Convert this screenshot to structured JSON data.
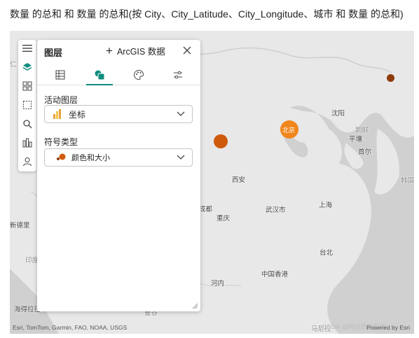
{
  "visual_title": "数量 的总和 和 数量 的总和(按 City、City_Latitude、City_Longitude、城市 和 数量 的总和)",
  "panel": {
    "title": "图层",
    "add_data_label": "ArcGIS 数据",
    "tabs": [
      "layers-tab",
      "symbology-tab",
      "style-tab",
      "settings-tab"
    ],
    "active_layer_label": "活动图层",
    "active_layer_value": "坐标",
    "symbol_type_label": "符号类型",
    "symbol_type_value": "颜色和大小"
  },
  "map": {
    "cities": [
      {
        "name": "北京",
        "style": "on-bubble"
      },
      {
        "name": "沈阳",
        "style": "normal"
      },
      {
        "name": "朝鲜",
        "style": "faint"
      },
      {
        "name": "平壤",
        "style": "normal"
      },
      {
        "name": "首尔",
        "style": "normal"
      },
      {
        "name": "西安",
        "style": "normal"
      },
      {
        "name": "成都",
        "style": "normal"
      },
      {
        "name": "重庆",
        "style": "normal"
      },
      {
        "name": "武汉市",
        "style": "normal"
      },
      {
        "name": "上海",
        "style": "normal"
      },
      {
        "name": "台北",
        "style": "normal"
      },
      {
        "name": "中国香港",
        "style": "normal"
      },
      {
        "name": "河内",
        "style": "normal"
      },
      {
        "name": "新德里",
        "style": "normal"
      },
      {
        "name": "印度",
        "style": "faint"
      },
      {
        "name": "海得拉巴",
        "style": "normal"
      },
      {
        "name": "曼谷",
        "style": "faint"
      },
      {
        "name": "仁",
        "style": "faint"
      },
      {
        "name": "韩国",
        "style": "faint"
      },
      {
        "name": "马尼拉",
        "style": "faint"
      }
    ],
    "bubble_colors": {
      "large": "#f0861c",
      "medium": "#cf5a0c",
      "small": "#8e3a0a"
    },
    "attribution": "Esri, TomTom, Garmin, FAO, NOAA, USGS",
    "powered_by": "Powered by Esri",
    "watermark": "CSDN @阿达的达尼亚"
  }
}
